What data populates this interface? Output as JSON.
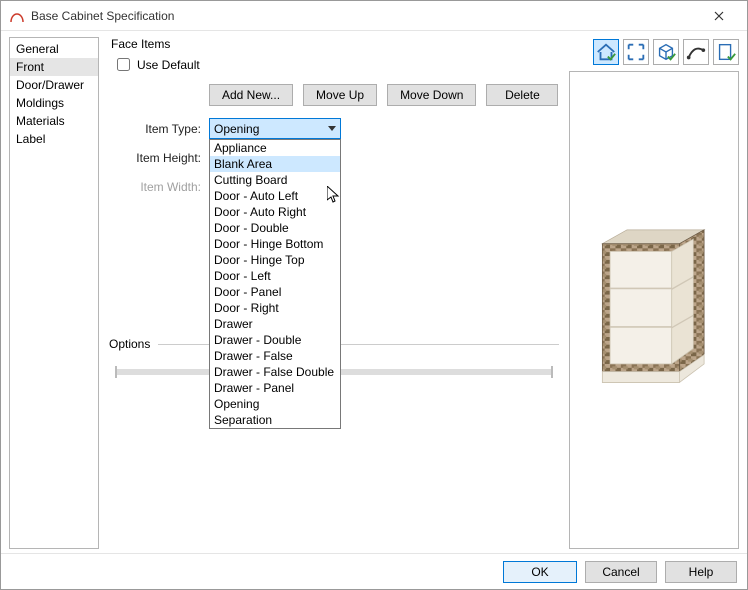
{
  "window": {
    "title": "Base Cabinet Specification"
  },
  "nav": {
    "items": [
      {
        "label": "General"
      },
      {
        "label": "Front",
        "selected": true
      },
      {
        "label": "Door/Drawer"
      },
      {
        "label": "Moldings"
      },
      {
        "label": "Materials"
      },
      {
        "label": "Label"
      }
    ]
  },
  "face_items": {
    "group_label": "Face Items",
    "use_default_label": "Use Default",
    "use_default_checked": false,
    "buttons": {
      "add_new": "Add New...",
      "move_up": "Move Up",
      "move_down": "Move Down",
      "delete": "Delete"
    },
    "item_type_label": "Item Type:",
    "item_type_value": "Opening",
    "item_type_options": [
      "Appliance",
      "Blank Area",
      "Cutting Board",
      "Door - Auto Left",
      "Door - Auto Right",
      "Door - Double",
      "Door - Hinge Bottom",
      "Door - Hinge Top",
      "Door - Left",
      "Door - Panel",
      "Door - Right",
      "Drawer",
      "Drawer - Double",
      "Drawer - False",
      "Drawer - False Double",
      "Drawer - Panel",
      "Opening",
      "Separation"
    ],
    "item_type_highlighted": "Blank Area",
    "item_height_label": "Item Height:",
    "item_height_value": "",
    "item_width_label": "Item Width:",
    "item_width_value": ""
  },
  "options": {
    "label": "Options"
  },
  "toolbar_icons": [
    "home-check-icon",
    "expand-icon",
    "cube-check-icon",
    "curve-icon",
    "page-check-icon"
  ],
  "footer": {
    "ok": "OK",
    "cancel": "Cancel",
    "help": "Help"
  }
}
